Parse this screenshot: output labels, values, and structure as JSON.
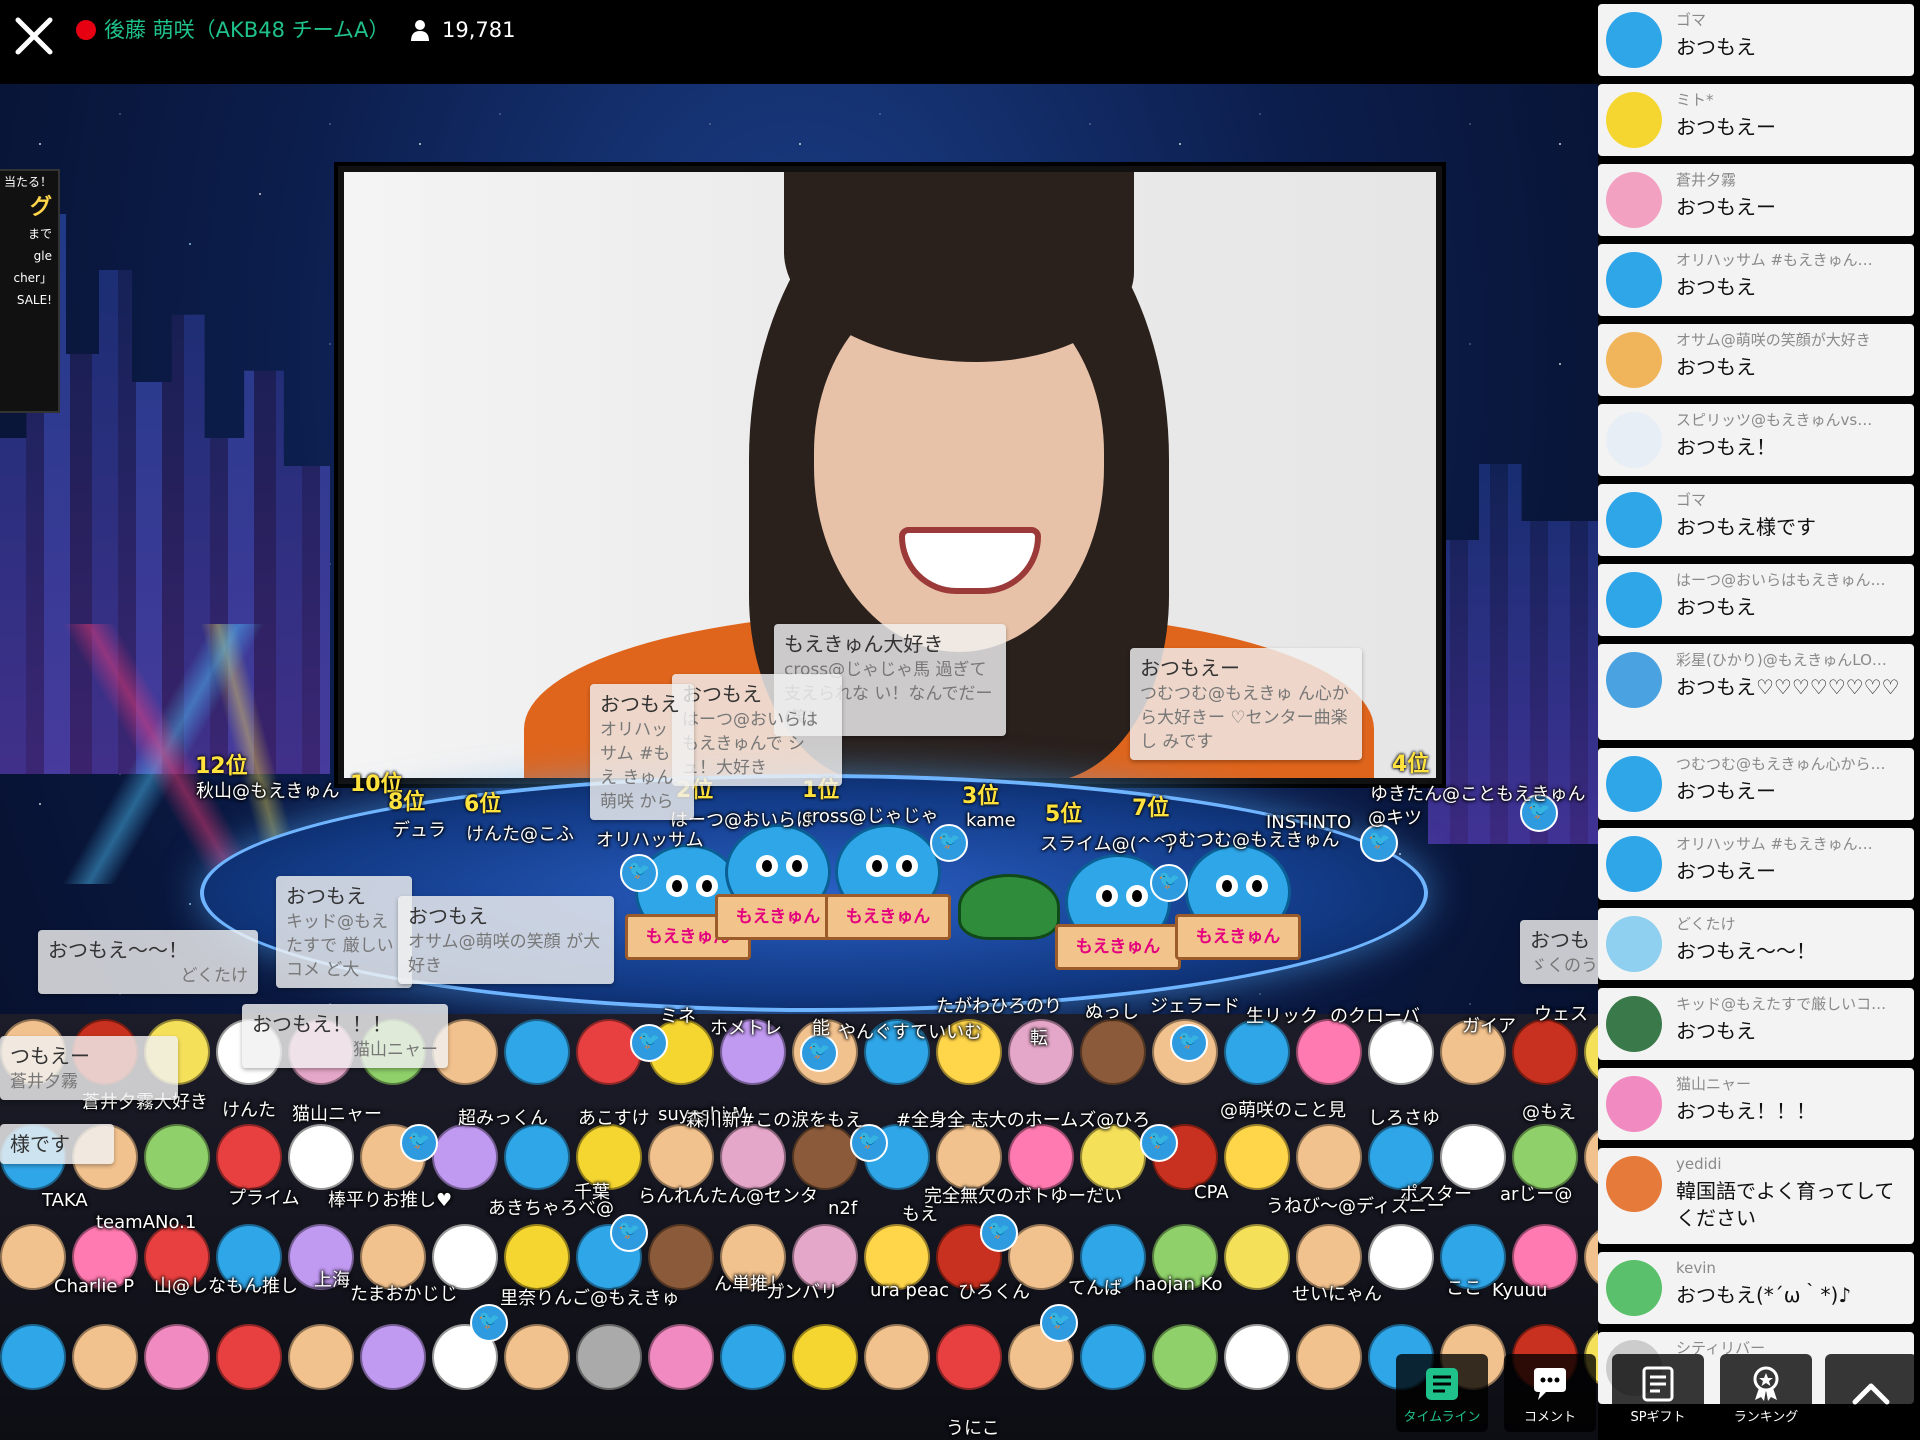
{
  "header": {
    "streamer_name": "後藤 萌咲（AKB48 チームA）",
    "viewer_count": "19,781",
    "live_color": "#e60012",
    "accent_color": "#1fc28a"
  },
  "promo": [
    "当たる！",
    "グ",
    "まで",
    "gle",
    "cher」",
    "SALE!"
  ],
  "mascot_sign": "もえきゅん",
  "ranks": [
    "12位",
    "10位",
    "8位",
    "6位",
    "2位",
    "1位",
    "3位",
    "5位",
    "7位",
    "4位"
  ],
  "bubbles": [
    {
      "title": "もえきゅん大好き",
      "sub": "cross@じゃじゃ馬 過ぎて支えられな い！なんでだー(笑)"
    },
    {
      "title": "おつもえ",
      "sub": "はーつ@おいらは もえきゅんで シュ！大好き"
    },
    {
      "title": "おつもえ",
      "sub": "オリハッサム #もえ きゅん 萌咲 から"
    },
    {
      "title": "おつもえー",
      "sub": "つむつむ@もえきゅ ん心から大好きー ♡センター曲楽し みです"
    },
    {
      "title": "おつもえ",
      "sub": "キッド@もえたすで 厳しいコメ ど大"
    },
    {
      "title": "おつもえ",
      "sub": "オサム@萌咲の笑顔 が大好き"
    },
    {
      "title": "おつもえ〜〜！",
      "sub": "どくたけ"
    },
    {
      "title": "おつもえ！！！",
      "sub": "猫山ニャー"
    },
    {
      "title": "つもえー",
      "sub": "蒼井夕霧"
    },
    {
      "title": "様です",
      "sub": ""
    },
    {
      "title": "おつも",
      "sub": "ゞくのう"
    }
  ],
  "fans": [
    "秋山@もえきゅん",
    "デュラ",
    "けんた@こふ",
    "オリハッサム",
    "はーつ@おいらは",
    "cross@じゃじゃ",
    "kame",
    "スライム@(^^)",
    "つむつむ@もえきゅん",
    "ゆきたん@こともえきゅん",
    "INSTINTO",
    "@キツ",
    "たがわひろのり",
    "ぬっし",
    "ジェラード",
    "生リック",
    "のクローバ",
    "ガイア",
    "ウェス",
    "ミネ",
    "ホメトレ",
    "能",
    "やんぐすていいむ",
    "転",
    "蒼井夕霧大好き",
    "けんた",
    "猫山ニャー",
    "超みっくん",
    "あこすけ",
    "suyoshi M",
    "森川新#この涙をもえ",
    "#全身全 志大のホームズ@ひろ",
    "@萌咲のこと見",
    "しろさゆ",
    "@もえ",
    "TAKA",
    "teamANo.1",
    "プライム",
    "棒平りお推し♥",
    "あきちゃろべ@",
    "千葉",
    "らんれんたん@センタ",
    "完全無欠のボトゆーだい",
    "CPA",
    "うねび〜@ディズニー",
    "ポスター",
    "arじー@",
    "Charlie P",
    "山@しなもん推し",
    "上海",
    "たまおかじじ",
    "里奈りんご@もえきゅ",
    "ん単推し",
    "ガンバリ",
    "ura peac",
    "ひろくん",
    "てんば",
    "haojan Ko",
    "せいにゃん",
    "ここ",
    "Kyuuu",
    "n2f",
    "もえ",
    "うにこ"
  ],
  "comments": [
    {
      "name": "ゴマ",
      "text": "おつもえ",
      "avatar_color": "#2fa6e8",
      "avatar": "moekyun-avatar"
    },
    {
      "name": "ミト*",
      "text": "おつもえー",
      "avatar_color": "#f5d631",
      "avatar": "duck-avatar"
    },
    {
      "name": "蒼井夕霧",
      "text": "おつもえー",
      "avatar_color": "#f2a1c1",
      "avatar": "rabbit-avatar"
    },
    {
      "name": "オリハッサム #もえきゅん…",
      "text": "おつもえ",
      "avatar_color": "#2fa6e8",
      "avatar": "moekyun-avatar"
    },
    {
      "name": "オサム@萌咲の笑顔が大好き",
      "text": "おつもえ",
      "avatar_color": "#f0b55a",
      "avatar": "cat-girl-avatar"
    },
    {
      "name": "スピリッツ@もえきゅんvs…",
      "text": "おつもえ！",
      "avatar_color": "#e8eef5",
      "avatar": "dog-avatar"
    },
    {
      "name": "ゴマ",
      "text": "おつもえ様です",
      "avatar_color": "#2fa6e8",
      "avatar": "moekyun-avatar"
    },
    {
      "name": "はーつ@おいらはもえきゅん…",
      "text": "おつもえ",
      "avatar_color": "#2fa6e8",
      "avatar": "moekyun-avatar"
    },
    {
      "name": "彩星(ひかり)@もえきゅんLO…",
      "text": "おつもえ♡♡♡♡♡♡♡♡",
      "avatar_color": "#4aa3e0",
      "avatar": "boy-avatar"
    },
    {
      "name": "つむつむ@もえきゅん心から…",
      "text": "おつもえー",
      "avatar_color": "#2fa6e8",
      "avatar": "moekyun-avatar"
    },
    {
      "name": "オリハッサム #もえきゅん…",
      "text": "おつもえー",
      "avatar_color": "#2fa6e8",
      "avatar": "moekyun-avatar"
    },
    {
      "name": "どくたけ",
      "text": "おつもえ〜〜！",
      "avatar_color": "#8fd0f0",
      "avatar": "jellyfish-avatar"
    },
    {
      "name": "キッド@もえたすで厳しいコ…",
      "text": "おつもえ",
      "avatar_color": "#3a7a4a",
      "avatar": "soldier-avatar"
    },
    {
      "name": "猫山ニャー",
      "text": "おつもえ！！！",
      "avatar_color": "#f08ac0",
      "avatar": "girl-avatar"
    },
    {
      "name": "yedidi",
      "text": "韓国語でよく育ってしてください",
      "avatar_color": "#e67a3a",
      "avatar": "girl-avatar"
    },
    {
      "name": "kevin",
      "text": "おつもえ(*´ω｀*)♪",
      "avatar_color": "#5bc06b",
      "avatar": "boy-avatar"
    },
    {
      "name": "シティリバー",
      "text": "",
      "avatar_color": "#cccccc",
      "avatar": "person-avatar"
    }
  ],
  "nav": {
    "timeline": "タイムライン",
    "comment": "コメント",
    "sp_gift": "SPギフト",
    "ranking": "ランキング"
  },
  "icons": {
    "close": "close-icon",
    "viewer": "person-icon",
    "timeline": "timeline-icon",
    "comment": "speech-bubble-icon",
    "sp_gift": "gift-list-icon",
    "ranking": "ribbon-medal-icon",
    "scroll_top": "chevron-up-icon"
  }
}
